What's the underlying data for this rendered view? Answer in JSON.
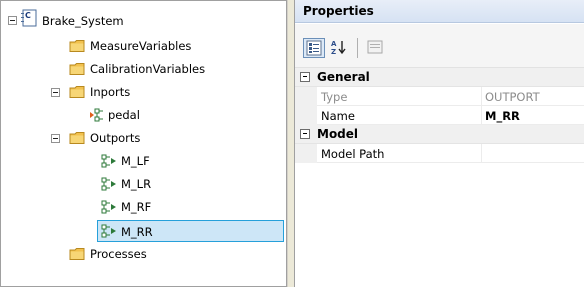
{
  "tree": {
    "root": {
      "label": "Brake_System",
      "icon": "chip-root-icon"
    },
    "nodes": [
      {
        "label": "MeasureVariables",
        "icon": "folder-icon"
      },
      {
        "label": "CalibrationVariables",
        "icon": "folder-icon"
      },
      {
        "label": "Inports",
        "icon": "folder-icon"
      },
      {
        "label": "pedal",
        "icon": "inport-icon"
      },
      {
        "label": "Outports",
        "icon": "folder-icon"
      },
      {
        "label": "M_LF",
        "icon": "outport-icon"
      },
      {
        "label": "M_LR",
        "icon": "outport-icon"
      },
      {
        "label": "M_RF",
        "icon": "outport-icon"
      },
      {
        "label": "M_RR",
        "icon": "outport-icon"
      },
      {
        "label": "Processes",
        "icon": "folder-icon"
      }
    ],
    "selected": "M_RR"
  },
  "properties": {
    "title": "Properties",
    "toolbar": {
      "categorized_icon": "categorized-icon",
      "alphabetical_icon": "sort-az-icon",
      "property_pages_icon": "property-pages-icon"
    },
    "categories": [
      {
        "name": "General",
        "rows": [
          {
            "name": "Type",
            "value": "OUTPORT"
          },
          {
            "name": "Name",
            "value": "M_RR"
          }
        ]
      },
      {
        "name": "Model",
        "rows": [
          {
            "name": "Model Path",
            "value": ""
          }
        ]
      }
    ]
  },
  "colors": {
    "selection_bg": "#cde6f7",
    "selection_border": "#26a0da",
    "folder": "#f2c14e",
    "header_bg": "#d6e2f3"
  }
}
